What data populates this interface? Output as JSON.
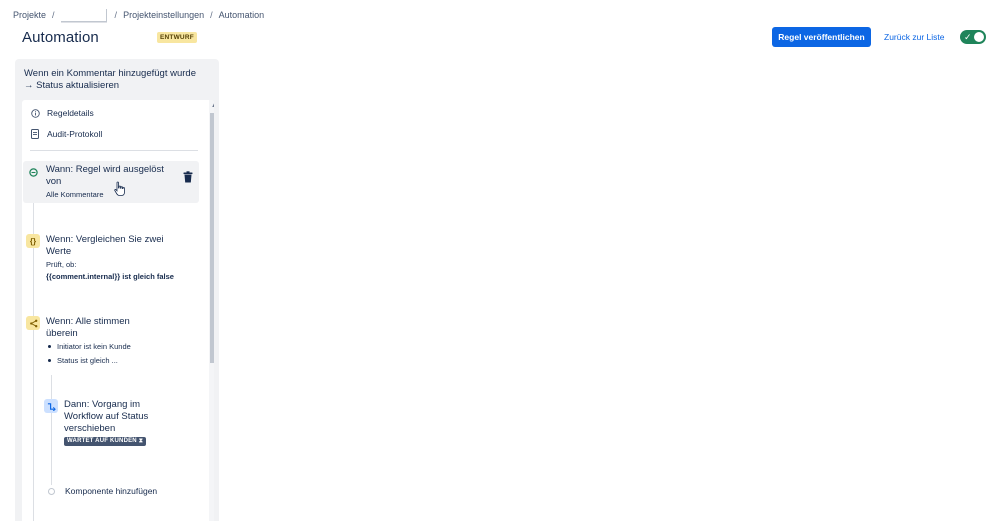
{
  "breadcrumb": {
    "projects": "Projekte",
    "sep": "/",
    "settings": "Projekteinstellungen",
    "automation": "Automation"
  },
  "header": {
    "title": "Automation",
    "badge": "ENTWURF",
    "publish_label": "Regel veröffentlichen",
    "back_label": "Zurück zur Liste",
    "toggle_check": "✓"
  },
  "panel": {
    "title": "Wenn ein Kommentar hinzugefügt wurde → Status aktualisieren",
    "rule_details": "Regeldetails",
    "audit_log": "Audit-Protokoll"
  },
  "steps": {
    "trigger": {
      "title": "Wann: Regel wird ausgelöst von",
      "subtitle": "Alle Kommentare"
    },
    "compare": {
      "icon_text": "{}",
      "title": "Wenn: Vergleichen Sie zwei Werte",
      "subtitle": "Prüft, ob:",
      "expression": "{{comment.internal}} ist gleich false"
    },
    "all_match": {
      "title": "Wenn: Alle stimmen überein",
      "bullets": [
        "Initiator ist kein Kunde",
        "Status ist gleich ..."
      ]
    },
    "transition": {
      "title": "Dann: Vorgang im Workflow auf Status verschieben",
      "status": "WARTET AUF KUNDEN ⧗"
    },
    "add_component": "Komponente hinzufügen"
  },
  "icons": {
    "info": "info-icon",
    "audit": "document-icon",
    "trigger": "comment-trigger-icon",
    "compare": "braces-icon",
    "branch": "branch-icon",
    "transition": "transition-icon",
    "delete": "trash-icon"
  },
  "colors": {
    "accent": "#0c66e4",
    "toggle_on": "#1f845a",
    "badge_bg": "#f8e6a0",
    "condition_icon_bg": "#f8e6a0",
    "action_icon_bg": "#cce0ff",
    "trigger_icon": "#1f845a"
  }
}
